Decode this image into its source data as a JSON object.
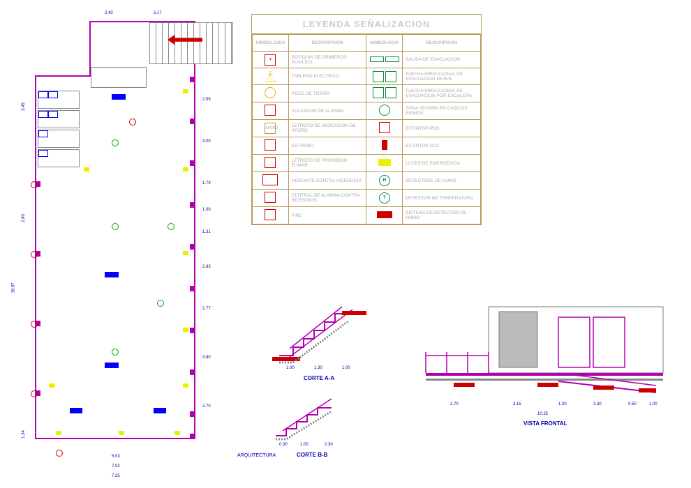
{
  "legend": {
    "title": "LEYENDA SEÑALIZACION",
    "headers": [
      "SIMBOLOGIA",
      "DESCRIPCION",
      "SIMBOLOGIA",
      "DESCRIPCION"
    ],
    "rows": [
      [
        "BOTIQUIN DE PRIMEROS AUXILIOS",
        "SALIDA DE EVACUACION"
      ],
      [
        "TABLERO ELECTRICO",
        "FLECHA DIRECCIONAL DE EVACUACION MURAL"
      ],
      [
        "POZO DE TIERRA",
        "FLECHA DIRECCIONAL DE EVACUACION POR ESCALERA"
      ],
      [
        "PULSADOR DE ALARMA",
        "ZONA SEGURA EN CASO DE SISMOS"
      ],
      [
        "LETRERO DE INDICACION DE AFORO",
        "EXTINTOR PQS"
      ],
      [
        "ESTROBO",
        "EXTINTOR CO2"
      ],
      [
        "LETRERO DE PROHIBIDO FUMAR",
        "LUCES DE EMERGENCIA"
      ],
      [
        "HIDRANTE CONTRA INCENDIOS",
        "DETECTORE DE HUMO"
      ],
      [
        "CENTRAL DE ALARMA CONTRA INCENDIOS",
        "DETECTOR DE TEMPERATURA"
      ],
      [
        "FIRE",
        "SISTEMA DE DETECTOR DE HUMO"
      ]
    ],
    "sym_left": [
      "cross-red",
      "triangle-yellow",
      "circle-yellow",
      "box-red",
      "aforo",
      "box-red",
      "box-red",
      "hydrant",
      "box-red",
      "box-red"
    ],
    "sym_right": [
      "salida-pair",
      "arrows-green",
      "arrows-green-stair",
      "circle-green",
      "ext-red",
      "ext-red",
      "luces-yellow",
      "circle-h",
      "circle-t",
      "red-bar"
    ]
  },
  "sections": {
    "corte_a": "CORTE A-A",
    "corte_b": "CORTE B-B",
    "vista": "VISTA FRONTAL",
    "arq": "ARQUITECTURA"
  },
  "dimensions": {
    "plan_top": [
      "2.40",
      "5.17"
    ],
    "plan_bottom": [
      "5.03",
      "7.02",
      "7.25"
    ],
    "plan_right_samples": [
      "2.55",
      "3.00",
      "1.79",
      "1.00",
      "1.31",
      "2.83",
      "2.77",
      "3.80",
      "2.70"
    ],
    "plan_left_samples": [
      "18.97",
      "3.45",
      "2.80",
      "1.34"
    ],
    "corte_a": [
      "1.00",
      "1.30",
      "1.00"
    ],
    "corte_b": [
      "0.30",
      "1.00",
      "0.30"
    ],
    "vista_bottom": [
      "2.70",
      "3.15",
      "1.00",
      "3.30",
      "0.50",
      "1.00"
    ],
    "vista_total": "10.25"
  },
  "plan_markers": {
    "column_count": 16,
    "green_h_circles": 5,
    "yellow_lights": 10,
    "blue_fixtures": 8,
    "red_detectors": 6
  },
  "colors": {
    "magenta": "#b000b0",
    "blue": "#0000ff",
    "dim_blue": "#0020aa",
    "red": "#cc0000",
    "green": "#0a8a3a",
    "yellow": "#eeee00",
    "legend_border": "#b89a5a"
  }
}
